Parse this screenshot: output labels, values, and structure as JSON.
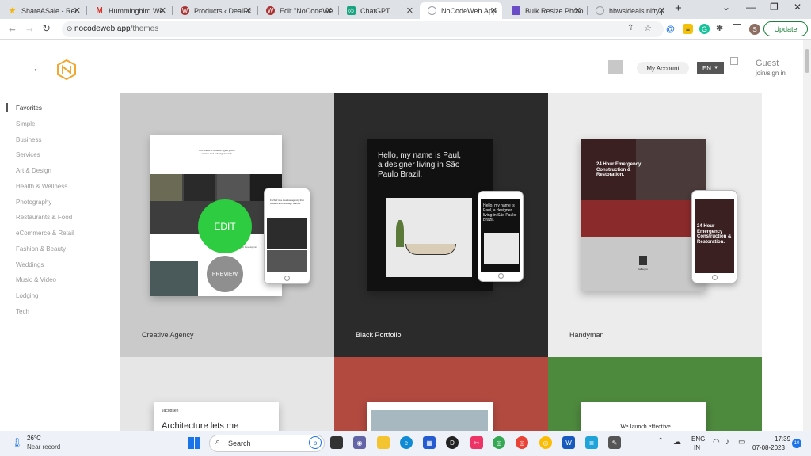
{
  "browser": {
    "tabs": [
      {
        "title": "ShareASale - Rec",
        "icon": "star-icon",
        "color": "#f5b400"
      },
      {
        "title": "Hummingbird We",
        "icon": "gmail-icon",
        "color": "#d93025"
      },
      {
        "title": "Products ‹ DealFc",
        "icon": "wordpress-icon",
        "color": "#a83232"
      },
      {
        "title": "Edit \"NoCodeWe",
        "icon": "wordpress-icon",
        "color": "#a83232"
      },
      {
        "title": "ChatGPT",
        "icon": "chatgpt-icon",
        "color": "#19a37f"
      },
      {
        "title": "NoCodeWeb.App",
        "icon": "globe-icon",
        "color": "#9aa0a6"
      },
      {
        "title": "Bulk Resize Photo",
        "icon": "resize-icon",
        "color": "#6a4cc7"
      },
      {
        "title": "hbwsldeals.nifty.p",
        "icon": "globe-icon",
        "color": "#9aa0a6"
      }
    ],
    "url_host": "nocodeweb.app",
    "url_path": "/themes",
    "profile_initial": "S",
    "update_label": "Update"
  },
  "header": {
    "my_account": "My Account",
    "language": "EN",
    "guest_name": "Guest",
    "guest_join": "join/sign in"
  },
  "sidebar": {
    "categories": [
      "Favorites",
      "Simple",
      "Business",
      "Services",
      "Art & Design",
      "Health & Wellness",
      "Photography",
      "Restaurants & Food",
      "eCommerce & Retail",
      "Fashion & Beauty",
      "Weddings",
      "Music & Video",
      "Lodging",
      "Tech"
    ]
  },
  "themes": [
    {
      "name": "Creative Agency",
      "edit": "EDIT",
      "preview": "PREVIEW",
      "headline": "FILTeR is a creative agency that creates and redesign brands.",
      "section_label": "Web Developmnt"
    },
    {
      "name": "Black Portfolio",
      "headline": "Hello, my name is Paul, a designer living in São Paulo Brazil.",
      "phone_headline": "Hello, my name is Paul, a designer living in São Paulo Brazil."
    },
    {
      "name": "Handyman",
      "headline": "24 Hour Emergency Construction & Restoration.",
      "person_label": "Call a pro"
    },
    {
      "name": "",
      "brand": "Jacobsen",
      "headline": "Architecture lets me"
    },
    {
      "name": ""
    },
    {
      "name": "",
      "headline": "We launch effective"
    }
  ],
  "taskbar": {
    "weather_temp": "26°C",
    "weather_desc": "Near record",
    "search_label": "Search",
    "lang_top": "ENG",
    "lang_bottom": "IN",
    "time": "17:39",
    "date": "07-08-2023",
    "notifications": "10"
  },
  "colors": {
    "edit_green": "#2ecc40",
    "handyman_red": "#8b2a2a",
    "black_cell": "#2b2b2b",
    "red_cell": "#b24a40",
    "green_cell": "#4e8a3e"
  }
}
